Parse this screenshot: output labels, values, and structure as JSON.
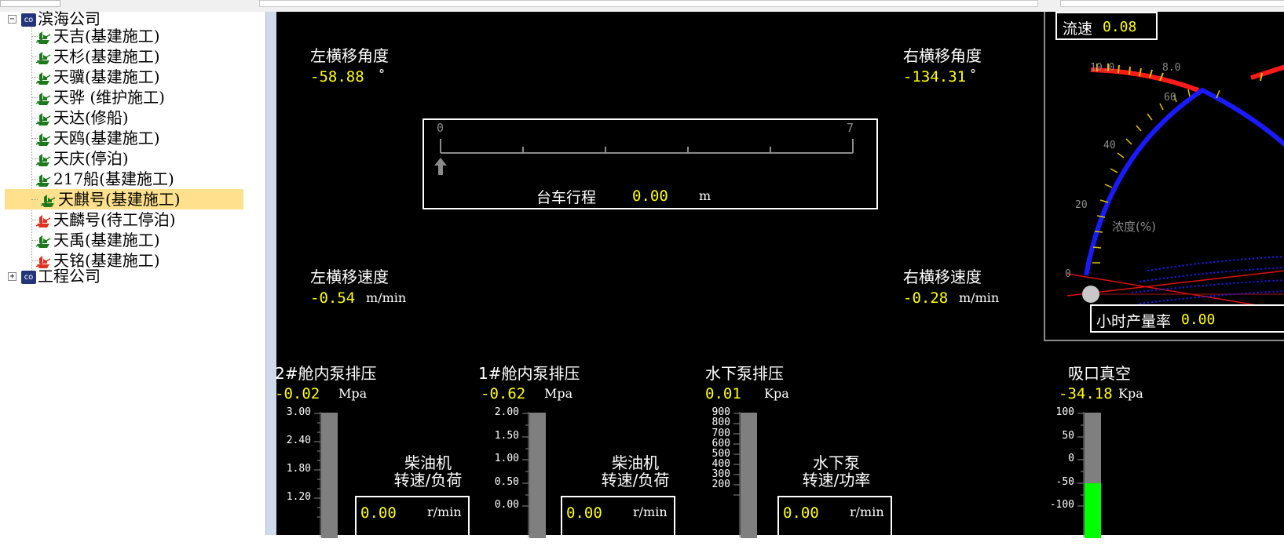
{
  "tree": {
    "root1": {
      "label": "滨海公司",
      "icon": "company-co-icon",
      "badge": "co"
    },
    "ships": [
      {
        "name": "天吉(基建施工)",
        "status": "active",
        "color": "#1c7a1c"
      },
      {
        "name": "天杉(基建施工)",
        "status": "active",
        "color": "#1c7a1c"
      },
      {
        "name": "天骥(基建施工)",
        "status": "active",
        "color": "#1c7a1c"
      },
      {
        "name": "天骅 (维护施工)",
        "status": "active",
        "color": "#1c7a1c"
      },
      {
        "name": "天达(修船)",
        "status": "active",
        "color": "#1c7a1c"
      },
      {
        "name": "天鸥(基建施工)",
        "status": "active",
        "color": "#1c7a1c"
      },
      {
        "name": "天庆(停泊)",
        "status": "active",
        "color": "#1c7a1c"
      },
      {
        "name": "217船(基建施工)",
        "status": "active",
        "color": "#1c7a1c"
      },
      {
        "name": "天麒号(基建施工)",
        "status": "active",
        "color": "#1c7a1c",
        "selected": true
      },
      {
        "name": "天麟号(待工停泊)",
        "status": "idle",
        "color": "#e03020"
      },
      {
        "name": "天禹(基建施工)",
        "status": "active",
        "color": "#1c7a1c"
      },
      {
        "name": "天铭(基建施工)",
        "status": "idle",
        "color": "#e03020"
      }
    ],
    "root2": {
      "label": "工程公司",
      "icon": "company-co-icon",
      "badge": "co"
    }
  },
  "panel": {
    "left_angle": {
      "label": "左横移角度",
      "value": "-58.88",
      "unit": "°"
    },
    "right_angle": {
      "label": "右横移角度",
      "value": "-134.31",
      "unit": "°"
    },
    "left_speed": {
      "label": "左横移速度",
      "value": "-0.54",
      "unit": "m/min"
    },
    "right_speed": {
      "label": "右横移速度",
      "value": "-0.28",
      "unit": "m/min"
    },
    "trolley": {
      "label": "台车行程",
      "value": "0.00",
      "unit": "m",
      "scale_min": "0",
      "scale_max": "7",
      "position_fraction": 0.0
    },
    "gauge": {
      "flow_label": "流速",
      "flow_value": "0.08",
      "density_label": "浓度(%)",
      "outer_ticks": [
        "10.0",
        "8.0"
      ],
      "inner_ticks": [
        "60",
        "40",
        "20",
        "0"
      ],
      "hourly_label": "小时产量率",
      "hourly_value": "0.00"
    },
    "pump2": {
      "label": "2#舱内泵排压",
      "value": "-0.02",
      "unit": "Mpa",
      "ticks": [
        "3.00",
        "2.40",
        "1.80",
        "1.20"
      ]
    },
    "pump1": {
      "label": "1#舱内泵排压",
      "value": "-0.62",
      "unit": "Mpa",
      "ticks": [
        "2.00",
        "1.50",
        "1.00",
        "0.50",
        "0.00"
      ]
    },
    "underwater": {
      "label": "水下泵排压",
      "value": "0.01",
      "unit": "Kpa",
      "ticks": [
        "900",
        "800",
        "700",
        "600",
        "500",
        "400",
        "300",
        "200"
      ]
    },
    "suction": {
      "label": "吸口真空",
      "value": "-34.18",
      "unit": "Kpa",
      "ticks": [
        "100",
        "50",
        "0",
        "-50",
        "-100"
      ],
      "fill_color": "#00ff00"
    },
    "engine1": {
      "title_line1": "柴油机",
      "title_line2": "转速/负荷",
      "value": "0.00",
      "unit": "r/min"
    },
    "engine2": {
      "title_line1": "柴油机",
      "title_line2": "转速/负荷",
      "value": "0.00",
      "unit": "r/min"
    },
    "wpump": {
      "title_line1": "水下泵",
      "title_line2": "转速/功率",
      "value": "0.00",
      "unit": "r/min"
    }
  }
}
